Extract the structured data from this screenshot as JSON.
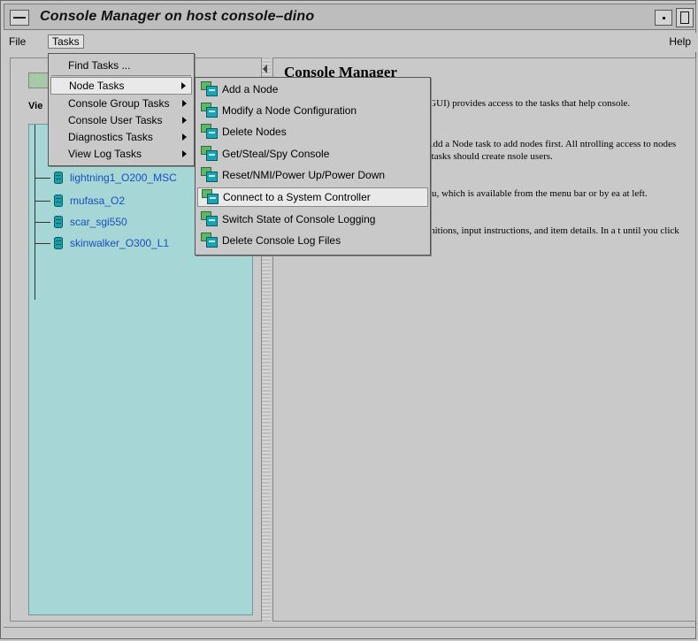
{
  "window": {
    "title": "Console Manager on host console–dino"
  },
  "menubar": {
    "file": "File",
    "tasks": "Tasks",
    "help": "Help"
  },
  "left_panel": {
    "view_label": "Vie",
    "tree_items": [
      "lightning1_O200_MSC",
      "mufasa_O2",
      "scar_sgi550",
      "skinwalker_O300_L1"
    ]
  },
  "right_panel": {
    "title": "Console Manager",
    "paragraphs": [
      "ce (GUI) provides access to the tasks that help console.",
      "he Add a Node task to add nodes first. All ntrolling access to nodes and tasks should create nsole users.",
      "menu, which is available from the menu bar or by ea at left.",
      "definitions, input instructions, and item details. In a t until you click OK."
    ]
  },
  "tasks_menu": {
    "items": [
      {
        "label": "Find Tasks ...",
        "submenu": false
      },
      {
        "label": "Node Tasks",
        "submenu": true
      },
      {
        "label": "Console Group Tasks",
        "submenu": true
      },
      {
        "label": "Console User Tasks",
        "submenu": true
      },
      {
        "label": "Diagnostics Tasks",
        "submenu": true
      },
      {
        "label": "View Log Tasks",
        "submenu": true
      }
    ]
  },
  "node_tasks_submenu": {
    "items": [
      "Add a Node",
      "Modify a Node Configuration",
      "Delete Nodes",
      "Get/Steal/Spy Console",
      "Reset/NMI/Power Up/Power Down",
      "Connect to a System Controller",
      "Switch State of Console Logging",
      "Delete Console Log Files"
    ],
    "selected": "Connect to a System Controller"
  },
  "colors": {
    "tree_bg": "#a7d6d6",
    "tree_text": "#1a4fbf",
    "icon_green": "#5fb76a",
    "icon_teal": "#1aa3b5"
  }
}
